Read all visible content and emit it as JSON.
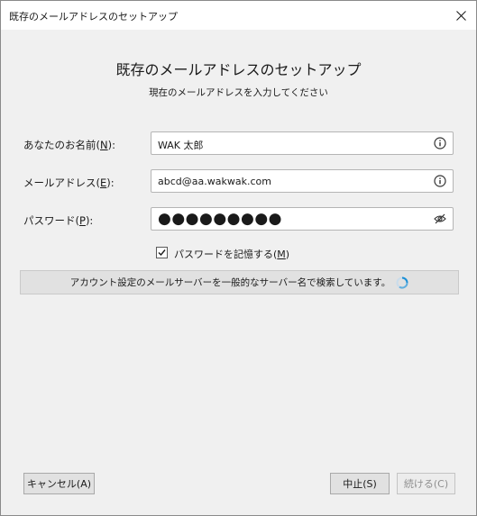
{
  "window": {
    "title": "既存のメールアドレスのセットアップ",
    "close_icon": "close-icon"
  },
  "header": {
    "heading": "既存のメールアドレスのセットアップ",
    "subheading": "現在のメールアドレスを入力してください"
  },
  "form": {
    "name": {
      "label": "あなたのお名前(",
      "accesskey": "N",
      "label_end": "):",
      "value": "WAK 太郎",
      "icon": "info-icon"
    },
    "email": {
      "label": "メールアドレス(",
      "accesskey": "E",
      "label_end": "):",
      "value": "abcd@aa.wakwak.com",
      "icon": "info-icon"
    },
    "password": {
      "label": "パスワード(",
      "accesskey": "P",
      "label_end": "):",
      "masked_value": "●●●●●●●●●",
      "icon": "eye-hidden-icon"
    },
    "remember": {
      "label": "パスワードを記憶する(",
      "accesskey": "M",
      "label_end": ")",
      "checked": true
    }
  },
  "status": {
    "text": "アカウント設定のメールサーバーを一般的なサーバー名で検索しています。",
    "icon": "spinner-icon",
    "accent": "#1a8fd6"
  },
  "buttons": {
    "cancel": "キャンセル(A)",
    "stop": "中止(S)",
    "continue": "続ける(C)"
  }
}
